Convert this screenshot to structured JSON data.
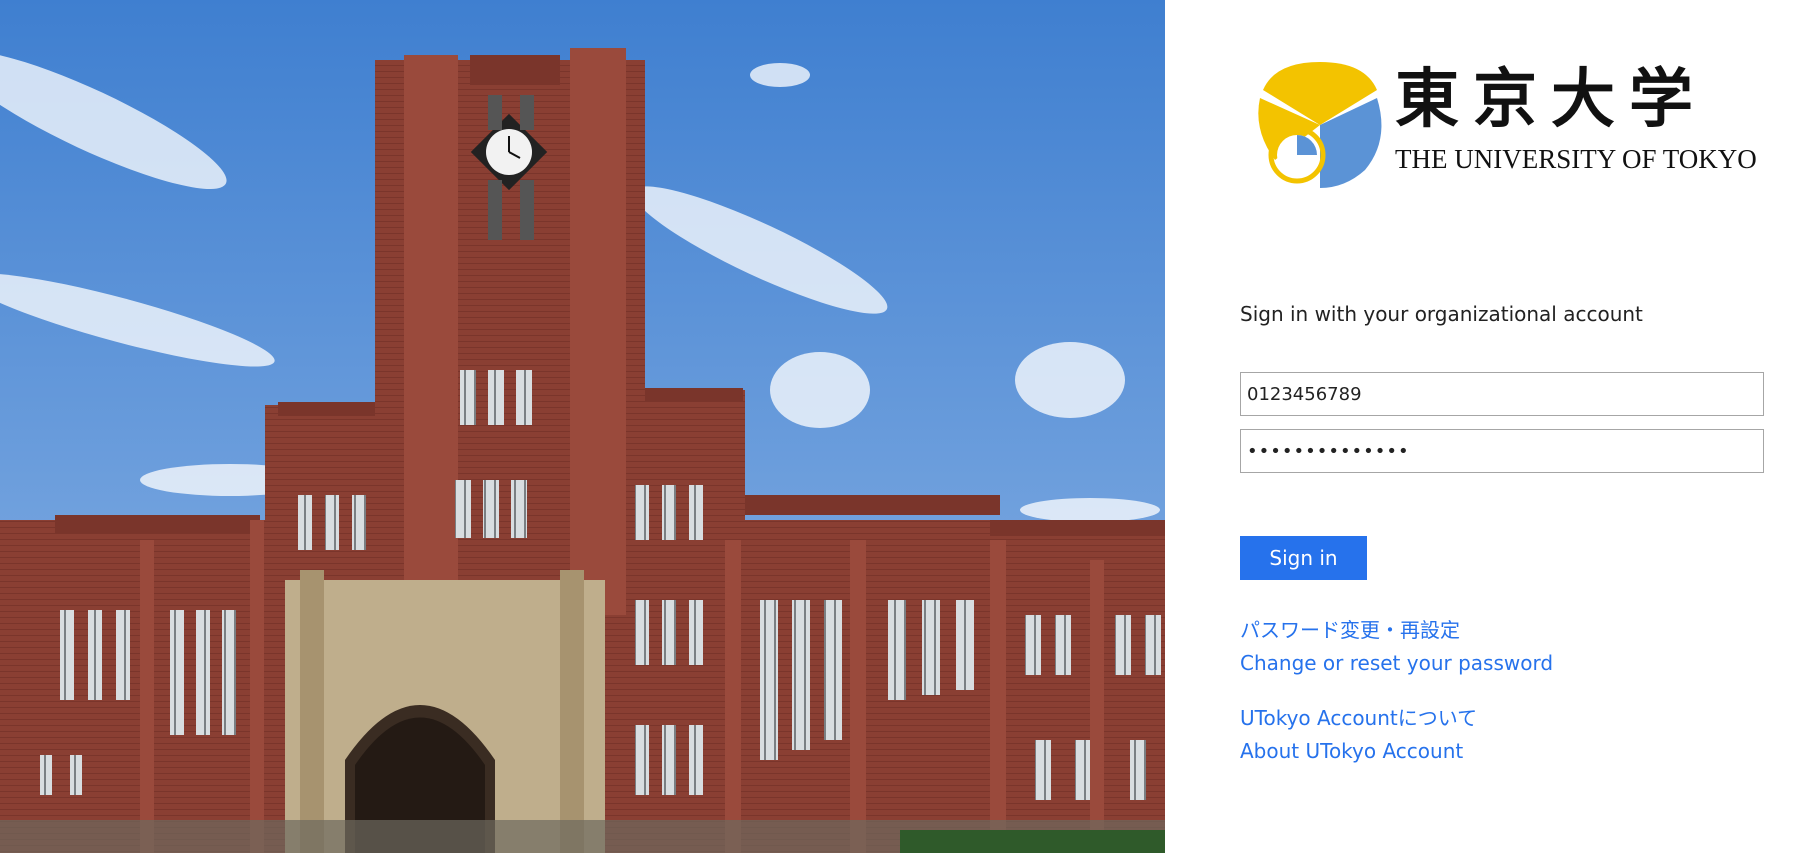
{
  "hero": {
    "image_subject": "university-building-photo"
  },
  "logo": {
    "kanji": "東京大学",
    "english": "THE UNIVERSITY OF TOKYO",
    "mark_colors": {
      "yellow": "#f3c300",
      "blue": "#5b93d6"
    }
  },
  "signin": {
    "heading": "Sign in with your organizational account",
    "username_value": "0123456789",
    "password_value": "••••••••••••••",
    "button_label": "Sign in"
  },
  "links": {
    "password_jp": "パスワード変更・再設定",
    "password_en": "Change or reset your password",
    "about_jp": "UTokyo Accountについて",
    "about_en": "About UTokyo Account"
  },
  "colors": {
    "accent": "#2672ec",
    "text": "#222222",
    "border": "#a6a6a6"
  }
}
